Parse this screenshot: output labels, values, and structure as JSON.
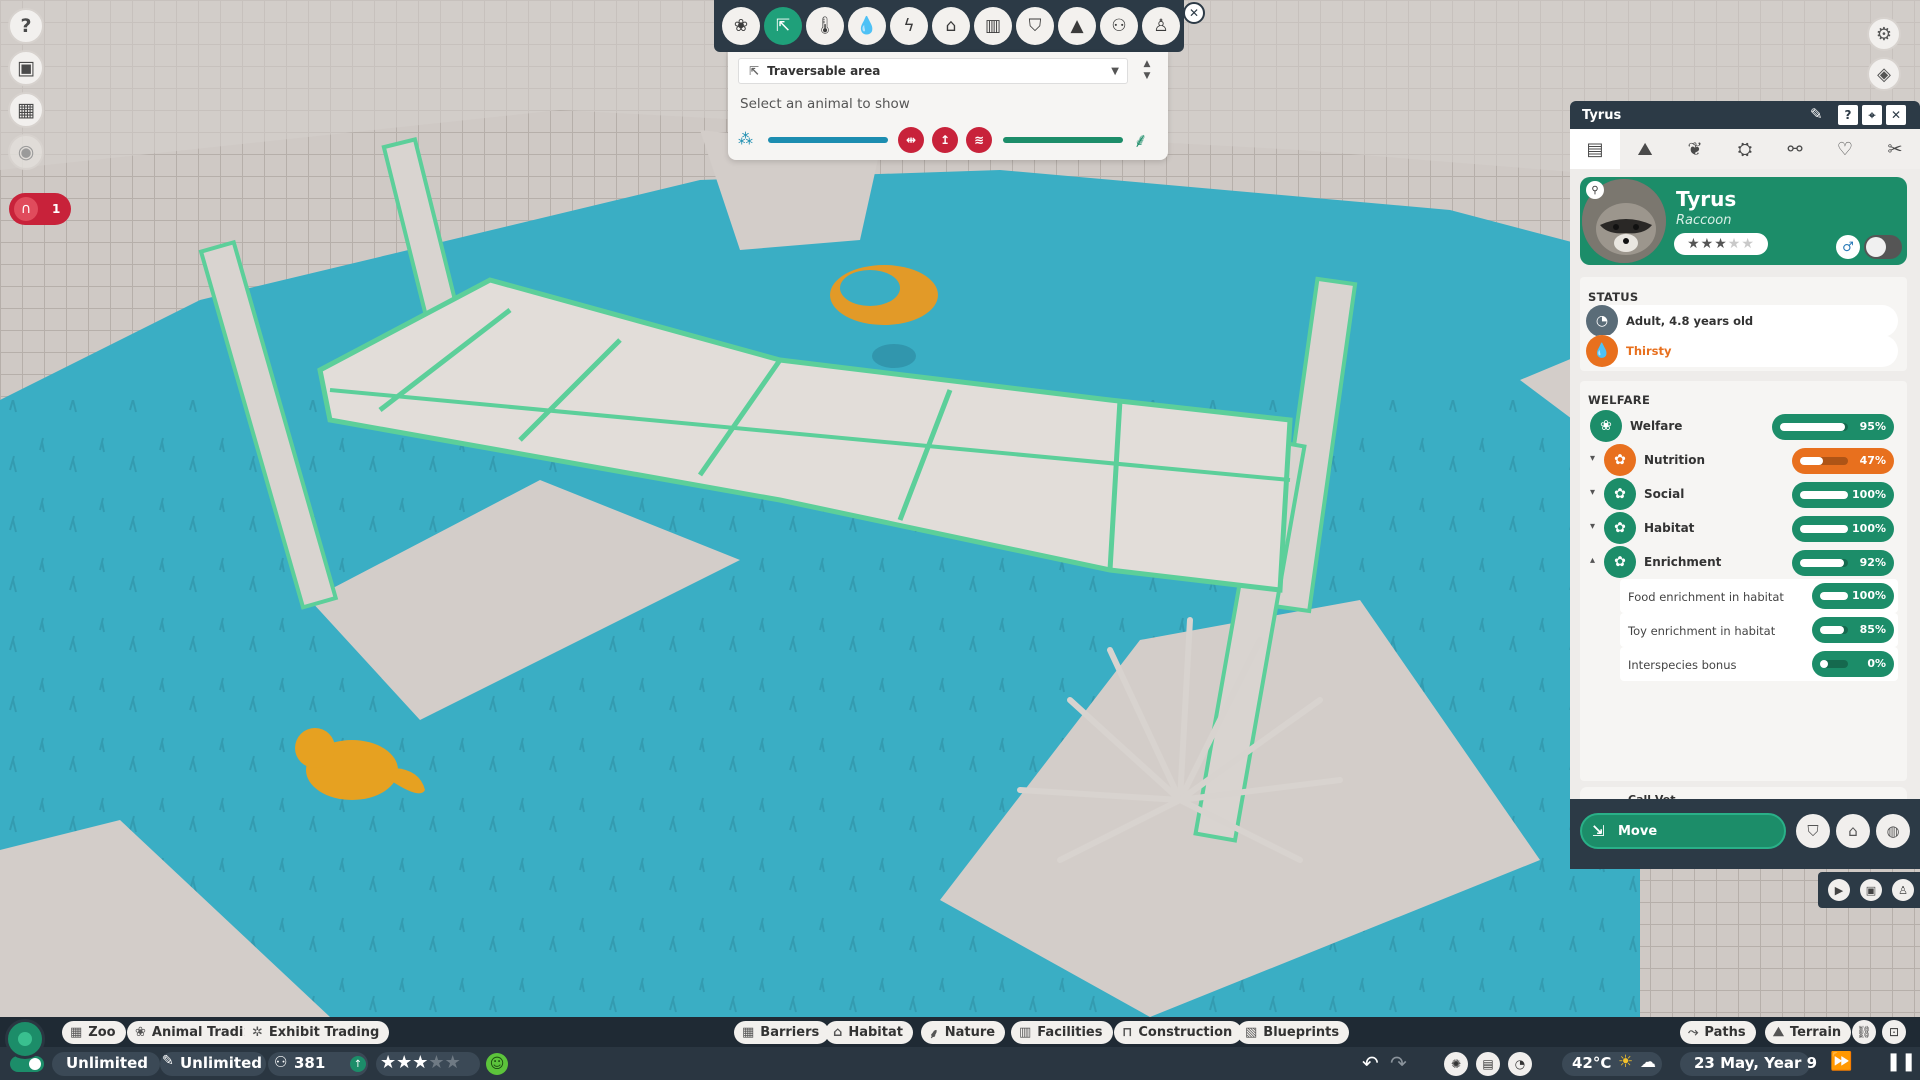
{
  "colors": {
    "accent_green": "#1c8d69",
    "warning_orange": "#e8701e",
    "danger_red": "#c8223a",
    "water_blue": "#3aaec4",
    "panel_dark": "#2c3a46"
  },
  "left_toolbar": {
    "items": [
      {
        "icon": "help-icon"
      },
      {
        "icon": "zoo-guide-icon"
      },
      {
        "icon": "calendar-icon"
      },
      {
        "icon": "visibility-icon"
      }
    ],
    "alert": {
      "icon": "habitat-alert-icon",
      "count": "1"
    }
  },
  "overlay": {
    "tools": [
      {
        "icon": "paw-icon",
        "active": false
      },
      {
        "icon": "traversable-area-icon",
        "active": true
      },
      {
        "icon": "temperature-icon",
        "active": false
      },
      {
        "icon": "water-icon",
        "active": false
      },
      {
        "icon": "power-icon",
        "active": false
      },
      {
        "icon": "shelter-icon",
        "active": false
      },
      {
        "icon": "facility-icon",
        "active": false
      },
      {
        "icon": "security-icon",
        "active": false
      },
      {
        "icon": "education-icon",
        "active": false
      },
      {
        "icon": "guests-icon",
        "active": false
      },
      {
        "icon": "staff-icon",
        "active": false
      }
    ],
    "dropdown_value": "Traversable area",
    "hint": "Select an animal to show"
  },
  "animal_panel": {
    "title": "Tyrus",
    "tabs": [
      "info-icon",
      "terrain-icon",
      "plant-icon",
      "enrichment-icon",
      "genetics-icon",
      "social-icon",
      "tools-icon"
    ],
    "name": "Tyrus",
    "species": "Raccoon",
    "stars": "★★★★★",
    "rating": 3,
    "sex": "♂",
    "status_title": "STATUS",
    "status": [
      {
        "text": "Adult, 4.8 years old",
        "icon": "age-icon",
        "color": "#5a6c78"
      },
      {
        "text": "Thirsty",
        "icon": "thirst-icon",
        "color": "#e8701e"
      }
    ],
    "welfare_title": "WELFARE",
    "welfare": {
      "label": "Welfare",
      "value": 95,
      "text": "95%"
    },
    "needs": [
      {
        "label": "Nutrition",
        "value": 47,
        "text": "47%",
        "color": "#e8701e",
        "caret": "▾"
      },
      {
        "label": "Social",
        "value": 100,
        "text": "100%",
        "color": "#1c8d69",
        "caret": "▾"
      },
      {
        "label": "Habitat",
        "value": 100,
        "text": "100%",
        "color": "#1c8d69",
        "caret": "▾"
      },
      {
        "label": "Enrichment",
        "value": 92,
        "text": "92%",
        "color": "#1c8d69",
        "caret": "▴"
      }
    ],
    "enrichment": [
      {
        "label": "Food enrichment in habitat",
        "value": 100,
        "text": "100%"
      },
      {
        "label": "Toy enrichment in habitat",
        "value": 85,
        "text": "85%"
      },
      {
        "label": "Interspecies bonus",
        "value": 0,
        "text": "0%"
      }
    ],
    "call_vet": "Call Vet",
    "move_label": "Move"
  },
  "bottom_bar": {
    "left_chips": [
      {
        "icon": "zoo-icon",
        "label": "Zoo"
      },
      {
        "icon": "paw-icon",
        "label": "Animal Trading"
      },
      {
        "icon": "exhibit-icon",
        "label": "Exhibit Trading"
      }
    ],
    "center_chips": [
      {
        "icon": "barrier-icon",
        "label": "Barriers"
      },
      {
        "icon": "habitat-icon",
        "label": "Habitat"
      },
      {
        "icon": "nature-icon",
        "label": "Nature"
      },
      {
        "icon": "facilities-icon",
        "label": "Facilities"
      },
      {
        "icon": "construction-icon",
        "label": "Construction"
      },
      {
        "icon": "blueprint-icon",
        "label": "Blueprints"
      }
    ],
    "right_chips": [
      {
        "icon": "paths-icon",
        "label": "Paths"
      },
      {
        "icon": "terrain-icon",
        "label": "Terrain"
      }
    ],
    "money": "Unlimited",
    "research": "Unlimited",
    "guests": "381",
    "zoo_stars": "★★★★★",
    "zoo_rating": 3,
    "temperature": "42°C",
    "date": "23 May, Year 9"
  }
}
